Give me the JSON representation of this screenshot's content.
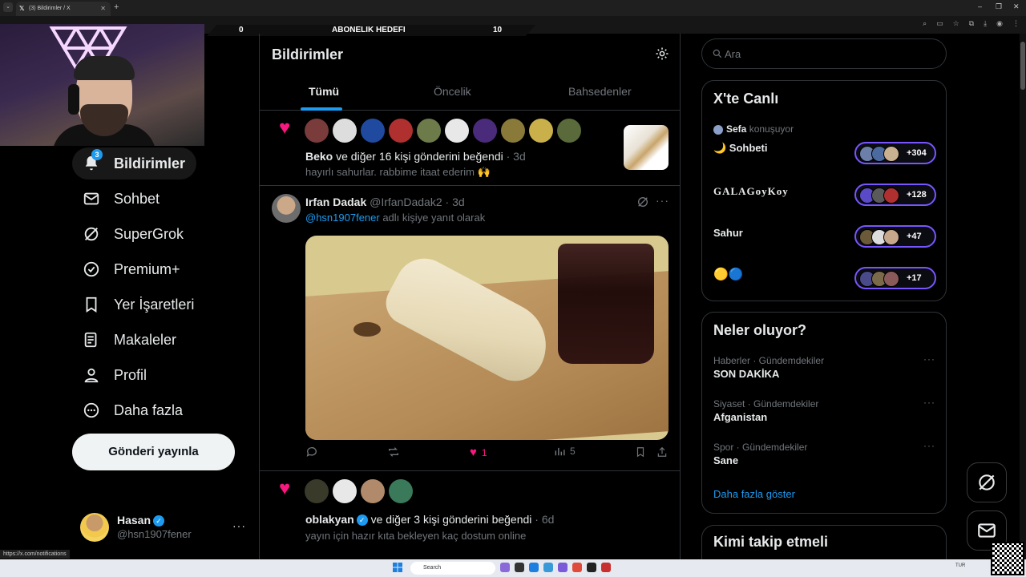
{
  "browser": {
    "tab_title": "(3) Bildirimler / X",
    "status_url": "https://x.com/notifications"
  },
  "overlay": {
    "left_count": "0",
    "title": "ABONELIK HEDEFI",
    "right_count": "10"
  },
  "nav": {
    "notifications_badge": "3",
    "items": [
      {
        "label": "Bildirimler",
        "icon": "bell-icon"
      },
      {
        "label": "Sohbet",
        "icon": "mail-icon"
      },
      {
        "label": "SuperGrok",
        "icon": "grok-icon"
      },
      {
        "label": "Premium+",
        "icon": "verified-badge-icon"
      },
      {
        "label": "Yer İşaretleri",
        "icon": "bookmark-icon"
      },
      {
        "label": "Makaleler",
        "icon": "article-icon"
      },
      {
        "label": "Profil",
        "icon": "person-icon"
      },
      {
        "label": "Daha fazla",
        "icon": "more-circle-icon"
      }
    ],
    "post_button": "Gönderi yayınla"
  },
  "account": {
    "name": "Hasan",
    "handle": "@hsn1907fener",
    "more": "···"
  },
  "main": {
    "title": "Bildirimler",
    "tabs": [
      "Tümü",
      "Öncelik",
      "Bahsedenler"
    ],
    "notif1": {
      "actor": "Beko",
      "text": " ve diğer 16 kişi gönderini beğendi",
      "time": " · 3d",
      "snippet": "hayırlı sahurlar. rabbime itaat ederim 🙌"
    },
    "tweet": {
      "name": "Irfan Dadak",
      "handle": "@IrfanDadak2",
      "time": " · 3d",
      "reply_mention": "@hsn1907fener",
      "reply_text": " adlı kişiye yanıt olarak",
      "likes": "1",
      "views": "5",
      "more": "···"
    },
    "notif2": {
      "actor": "oblakyan",
      "text": " ve diğer 3 kişi gönderini beğendi",
      "time": " · 6d",
      "snippet": "yayın için hazır kıta bekleyen kaç dostum online"
    }
  },
  "sidebar": {
    "search_placeholder": "Ara",
    "live": {
      "title": "X'te Canlı",
      "rows": [
        {
          "host": "Sefa",
          "host_suffix": " konuşuyor",
          "title": "🌙 Sohbeti",
          "count": "+304"
        },
        {
          "host": "",
          "host_suffix": "",
          "title": "GALAGoyKoy",
          "count": "+128"
        },
        {
          "host": "",
          "host_suffix": "",
          "title": "Sahur",
          "count": "+47"
        },
        {
          "host": "",
          "host_suffix": "",
          "title": "🟡🔵",
          "count": "+17"
        }
      ]
    },
    "trends": {
      "title": "Neler oluyor?",
      "items": [
        {
          "category": "Haberler · Gündemdekiler",
          "topic": "SON DAKİKA"
        },
        {
          "category": "Siyaset · Gündemdekiler",
          "topic": "Afganistan"
        },
        {
          "category": "Spor · Gündemdekiler",
          "topic": "Sane"
        }
      ],
      "show_more": "Daha fazla göster"
    },
    "who_to_follow": "Kimi takip etmeli"
  },
  "taskbar": {
    "search_label": "Search",
    "tray": "TUR"
  },
  "colors": {
    "accent": "#1d9bf0",
    "like": "#f91880",
    "live_border": "#7856ff"
  }
}
